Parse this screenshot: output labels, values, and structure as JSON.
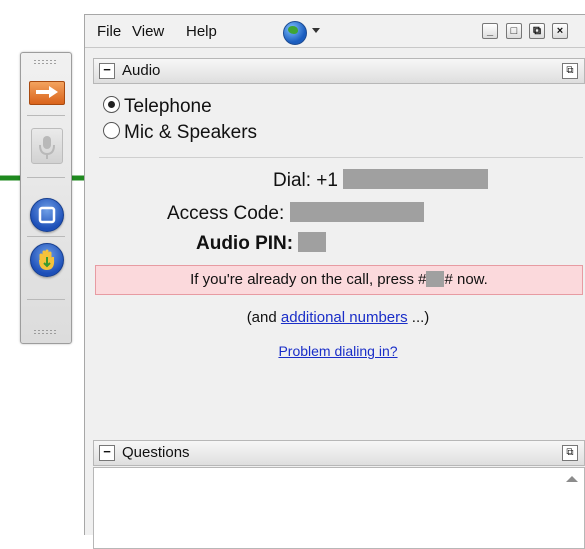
{
  "menu": {
    "file": "File",
    "view": "View",
    "help": "Help"
  },
  "window_buttons": {
    "minimize": "_",
    "maximize": "□",
    "popout": "⧉",
    "close": "×"
  },
  "audio": {
    "title": "Audio",
    "options": [
      {
        "label": "Telephone",
        "selected": true
      },
      {
        "label": "Mic & Speakers",
        "selected": false
      }
    ],
    "dial_label": "Dial: +1",
    "access_code_label": "Access Code:",
    "audio_pin_label": "Audio PIN:",
    "alert_prefix": "If you're already on the call, press #",
    "alert_suffix": "# now.",
    "additional_prefix": "(and ",
    "additional_link": "additional numbers",
    "additional_suffix": " ...)",
    "problem_link": "Problem dialing in?"
  },
  "questions": {
    "title": "Questions"
  },
  "colors": {
    "alert_bg": "#fbd9dc",
    "link": "#1a2ec8",
    "pointer": "#1f8a1f"
  }
}
